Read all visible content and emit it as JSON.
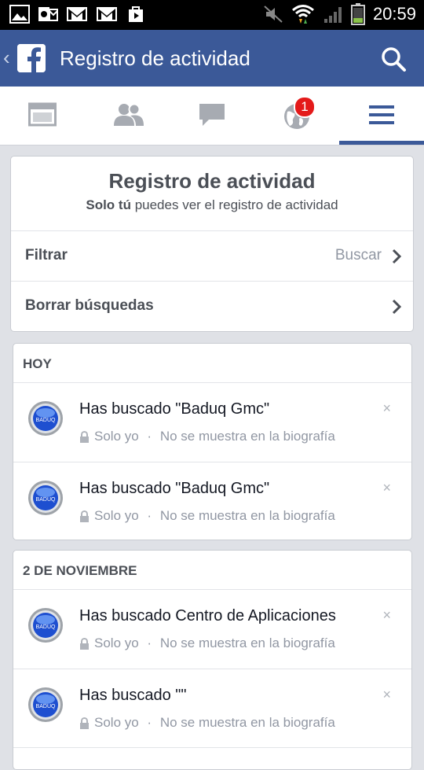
{
  "status_bar": {
    "time": "20:59",
    "left_icons": [
      "image-icon",
      "outlook-icon",
      "gmail-icon",
      "gmail-icon",
      "play-store-icon"
    ],
    "right_icons": [
      "mute-icon",
      "wifi-icon",
      "signal-icon",
      "battery-icon"
    ]
  },
  "header": {
    "title": "Registro de actividad"
  },
  "tabs": [
    {
      "name": "news-feed-icon",
      "active": false
    },
    {
      "name": "friends-icon",
      "active": false
    },
    {
      "name": "messages-icon",
      "active": false
    },
    {
      "name": "notifications-icon",
      "active": false,
      "badge": "1"
    },
    {
      "name": "menu-icon",
      "active": true
    }
  ],
  "intro": {
    "title": "Registro de actividad",
    "subtitle_bold": "Solo tú",
    "subtitle_rest": " puedes ver el registro de actividad"
  },
  "menu": {
    "filter_label": "Filtrar",
    "filter_action": "Buscar",
    "clear_label": "Borrar búsquedas"
  },
  "sections": [
    {
      "heading": "HOY",
      "entries": [
        {
          "title": "Has buscado \"Baduq Gmc\"",
          "privacy": "Solo yo",
          "sep": " · ",
          "visibility": "No se muestra en la biografía"
        },
        {
          "title": "Has buscado \"Baduq Gmc\"",
          "privacy": "Solo yo",
          "sep": " · ",
          "visibility": "No se muestra en la biografía"
        }
      ]
    },
    {
      "heading": "2 DE NOVIEMBRE",
      "entries": [
        {
          "title": "Has buscado Centro de Aplicaciones",
          "privacy": "Solo yo",
          "sep": " · ",
          "visibility": "No se muestra en la biografía"
        },
        {
          "title": "Has buscado \"\"",
          "privacy": "Solo yo",
          "sep": " · ",
          "visibility": "No se muestra en la biografía"
        }
      ]
    }
  ],
  "close_glyph": "×",
  "colors": {
    "brand": "#3b5998",
    "badge": "#e41a1a"
  }
}
